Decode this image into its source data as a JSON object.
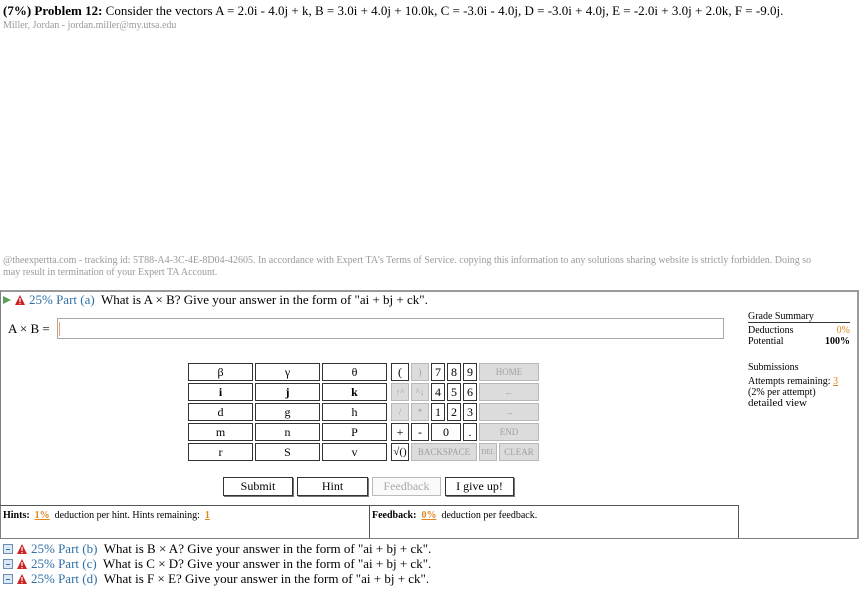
{
  "problem": {
    "weight": "(7%)",
    "number": "Problem 12:",
    "statement": "Consider the vectors A = 2.0i - 4.0j + k, B = 3.0i + 4.0j + 10.0k, C = -3.0i - 4.0j, D = -3.0i + 4.0j, E = -2.0i + 3.0j + 2.0k, F = -9.0j.",
    "student": "Miller, Jordan - jordan.miller@my.utsa.edu"
  },
  "tracking_notice": "@theexpertta.com - tracking id: 5T88-A4-3C-4E-8D04-42605. In accordance with Expert TA's Terms of Service. copying this information to any solutions sharing website is strictly forbidden. Doing so may result in termination of your Expert TA Account.",
  "part_a": {
    "percent": "25% Part (a)",
    "question": "What is A × B? Give your answer in the form of \"ai + bj + ck\".",
    "answer_label": "A × B =",
    "answer_value": ""
  },
  "grade_summary": {
    "title": "Grade Summary",
    "deductions_label": "Deductions",
    "deductions_value": "0%",
    "potential_label": "Potential",
    "potential_value": "100%"
  },
  "submissions": {
    "title": "Submissions",
    "attempts_label": "Attempts remaining:",
    "attempts_value": "3",
    "per_attempt": "(2% per attempt)",
    "detailed_view": "detailed view"
  },
  "symbols": [
    [
      "β",
      "γ",
      "θ"
    ],
    [
      "i",
      "j",
      "k"
    ],
    [
      "d",
      "g",
      "h"
    ],
    [
      "m",
      "n",
      "P"
    ],
    [
      "r",
      "S",
      "v"
    ]
  ],
  "keypad": {
    "open_paren": "(",
    "close_paren": ")",
    "up": "↑^",
    "down": "^↓",
    "divide": "/",
    "multiply": "*",
    "plus": "+",
    "minus": "-",
    "sqrt": "√()",
    "digits_row1": [
      "7",
      "8",
      "9"
    ],
    "digits_row2": [
      "4",
      "5",
      "6"
    ],
    "digits_row3": [
      "1",
      "2",
      "3"
    ],
    "zero": "0",
    "dot": ".",
    "home": "HOME",
    "left": "←",
    "right": "→",
    "end": "END",
    "backspace": "BACKSPACE",
    "del": "DEL",
    "clear": "CLEAR"
  },
  "buttons": {
    "submit": "Submit",
    "hint": "Hint",
    "feedback": "Feedback",
    "give_up": "I give up!"
  },
  "hints": {
    "label": "Hints:",
    "deduction": "1%",
    "text": "deduction per hint. Hints remaining:",
    "remaining": "1"
  },
  "feedback": {
    "label": "Feedback:",
    "deduction": "0%",
    "text": "deduction per feedback."
  },
  "other_parts": [
    {
      "percent": "25% Part (b)",
      "question": "What is B × A? Give your answer in the form of \"ai + bj + ck\"."
    },
    {
      "percent": "25% Part (c)",
      "question": "What is C × D? Give your answer in the form of \"ai + bj + ck\"."
    },
    {
      "percent": "25% Part (d)",
      "question": "What is F × E? Give your answer in the form of \"ai + bj + ck\"."
    }
  ],
  "colors": {
    "accent_orange": "#e0861f",
    "link_blue": "#2e6fa7",
    "warning_red": "#cc2222"
  }
}
